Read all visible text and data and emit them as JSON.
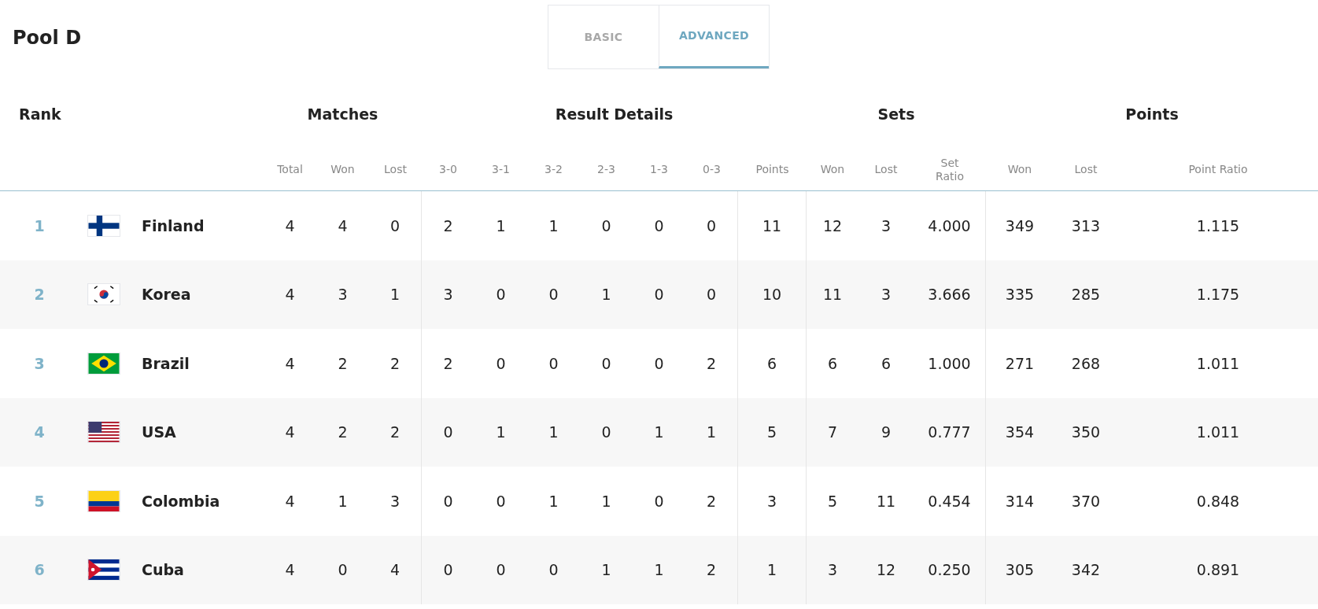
{
  "title": "Pool D",
  "tabs": [
    {
      "label": "BASIC",
      "selected": false
    },
    {
      "label": "ADVANCED",
      "selected": true
    }
  ],
  "group_headers": [
    "Rank",
    "Matches",
    "Result Details",
    "Sets",
    "Points"
  ],
  "columns": [
    "Total",
    "Won",
    "Lost",
    "3-0",
    "3-1",
    "3-2",
    "2-3",
    "1-3",
    "0-3",
    "Points",
    "Won",
    "Lost",
    "Set Ratio",
    "Won",
    "Lost",
    "Point Ratio"
  ],
  "rows": [
    {
      "rank": "1",
      "country": "Finland",
      "values": [
        "4",
        "4",
        "0",
        "2",
        "1",
        "1",
        "0",
        "0",
        "0",
        "11",
        "12",
        "3",
        "4.000",
        "349",
        "313",
        "1.115"
      ]
    },
    {
      "rank": "2",
      "country": "Korea",
      "values": [
        "4",
        "3",
        "1",
        "3",
        "0",
        "0",
        "1",
        "0",
        "0",
        "10",
        "11",
        "3",
        "3.666",
        "335",
        "285",
        "1.175"
      ]
    },
    {
      "rank": "3",
      "country": "Brazil",
      "values": [
        "4",
        "2",
        "2",
        "2",
        "0",
        "0",
        "0",
        "0",
        "2",
        "6",
        "6",
        "6",
        "1.000",
        "271",
        "268",
        "1.011"
      ]
    },
    {
      "rank": "4",
      "country": "USA",
      "values": [
        "4",
        "2",
        "2",
        "0",
        "1",
        "1",
        "0",
        "1",
        "1",
        "5",
        "7",
        "9",
        "0.777",
        "354",
        "350",
        "1.011"
      ]
    },
    {
      "rank": "5",
      "country": "Colombia",
      "values": [
        "4",
        "1",
        "3",
        "0",
        "0",
        "1",
        "1",
        "0",
        "2",
        "3",
        "5",
        "11",
        "0.454",
        "314",
        "370",
        "0.848"
      ]
    },
    {
      "rank": "6",
      "country": "Cuba",
      "values": [
        "4",
        "0",
        "4",
        "0",
        "0",
        "0",
        "1",
        "1",
        "2",
        "1",
        "3",
        "12",
        "0.250",
        "305",
        "342",
        "0.891"
      ]
    }
  ]
}
